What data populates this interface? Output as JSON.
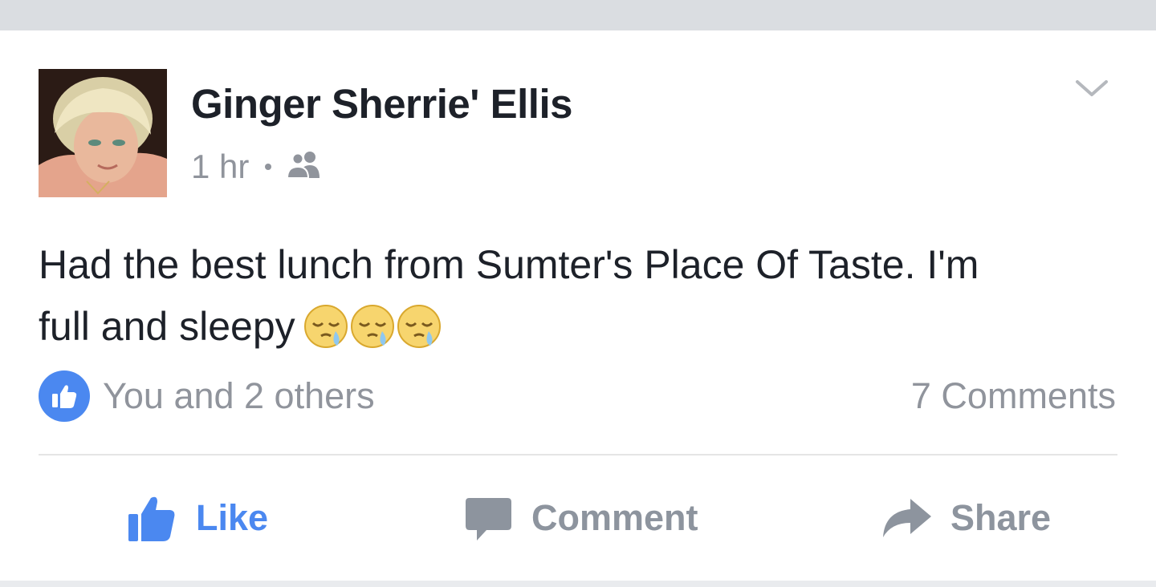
{
  "post": {
    "author": "Ginger Sherrie' Ellis",
    "time": "1 hr",
    "audience_icon": "friends-icon",
    "text_line1": "Had the best lunch from Sumter's Place Of Taste. I'm",
    "text_line2": "full and sleepy",
    "emoji_icon": "sleepy-face-icon",
    "emoji_count": 3
  },
  "reactions": {
    "summary": "You and 2 others",
    "comments": "7 Comments"
  },
  "actions": {
    "like": "Like",
    "comment": "Comment",
    "share": "Share"
  },
  "colors": {
    "accent": "#4b88f0",
    "text": "#1d2129",
    "muted": "#90949c",
    "background": "#dadde1"
  }
}
